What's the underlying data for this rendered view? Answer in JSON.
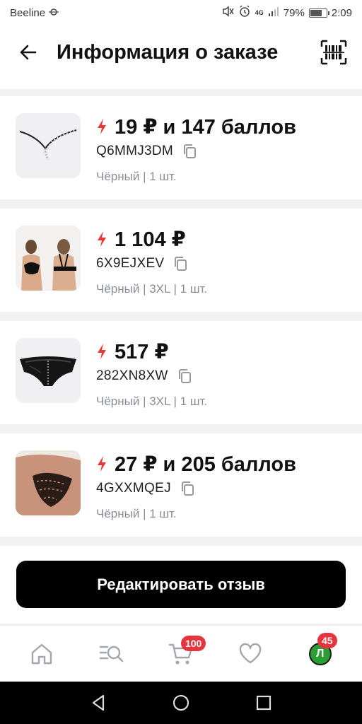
{
  "status_bar": {
    "carrier": "Beeline",
    "battery_percent": "79%",
    "battery_level": 0.79,
    "time": "2:09",
    "network": "4G"
  },
  "header": {
    "title": "Информация о заказе"
  },
  "items": [
    {
      "price": "19 ₽ и 147 баллов",
      "code": "Q6MMJ3DM",
      "meta": "Чёрный | 1 шт."
    },
    {
      "price": "1 104 ₽",
      "code": "6X9EJXEV",
      "meta": "Чёрный | 3XL | 1 шт."
    },
    {
      "price": "517 ₽",
      "code": "282XN8XW",
      "meta": "Чёрный | 3XL | 1 шт."
    },
    {
      "price": "27 ₽ и 205 баллов",
      "code": "4GXXMQEJ",
      "meta": "Чёрный | 1 шт."
    }
  ],
  "action": {
    "label": "Редактировать отзыв"
  },
  "bottom_nav": {
    "cart_badge": "100",
    "profile_badge": "45",
    "avatar_letter": "Л"
  },
  "colors": {
    "accent_red": "#e7333b",
    "lightning": "#e53935",
    "avatar_green": "#2a9d33",
    "meta_gray": "#8a8d96"
  }
}
